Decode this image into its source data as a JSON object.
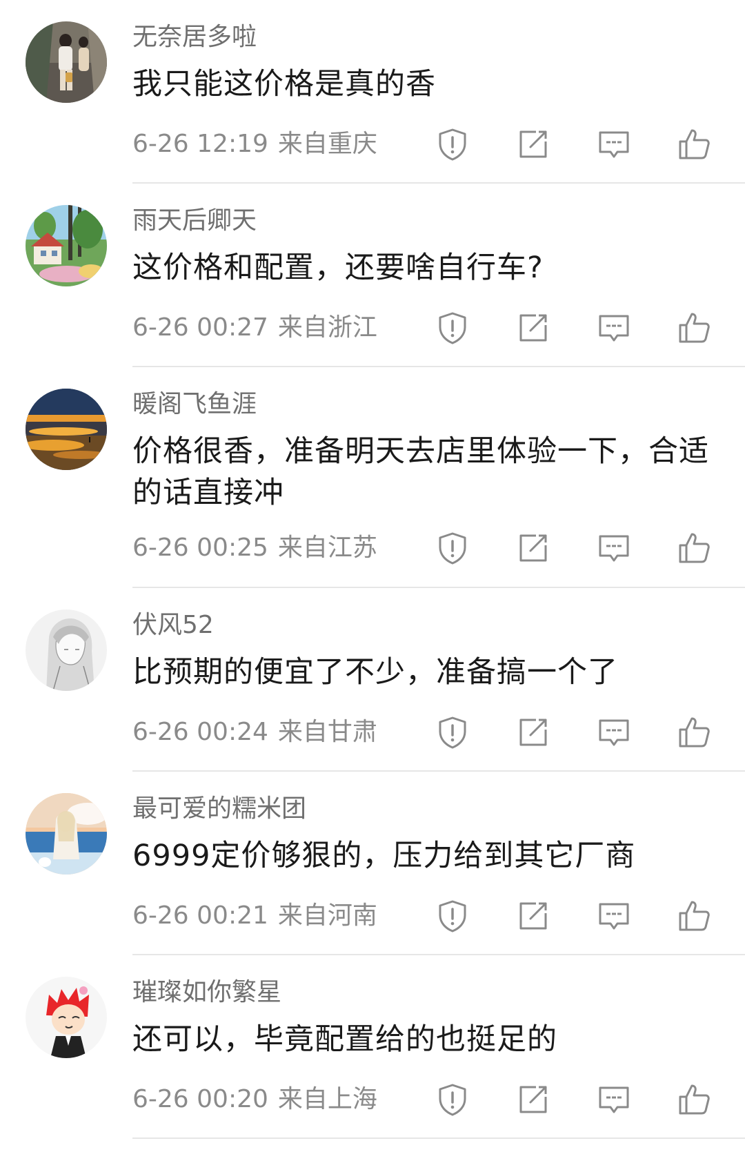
{
  "comments": [
    {
      "username": "无奈居多啦",
      "text": "我只能这价格是真的香",
      "date": "6-26 12:19",
      "location": "来自重庆",
      "avatar_icon": "photo-street-girl"
    },
    {
      "username": "雨天后卿天",
      "text": "这价格和配置，还要啥自行车?",
      "date": "6-26 00:27",
      "location": "来自浙江",
      "avatar_icon": "illustration-house-forest"
    },
    {
      "username": "暖阁飞鱼涯",
      "text": "价格很香，准备明天去店里体验一下，合适的话直接冲",
      "date": "6-26 00:25",
      "location": "来自江苏",
      "avatar_icon": "photo-sunset-sea"
    },
    {
      "username": "伏风52",
      "text": "比预期的便宜了不少，准备搞一个了",
      "date": "6-26 00:24",
      "location": "来自甘肃",
      "avatar_icon": "sketch-girl"
    },
    {
      "username": "最可爱的糯米团",
      "text": "6999定价够狠的，压力给到其它厂商",
      "date": "6-26 00:21",
      "location": "来自河南",
      "avatar_icon": "illustration-girl-sea"
    },
    {
      "username": "璀璨如你繁星",
      "text": "还可以，毕竟配置给的也挺足的",
      "date": "6-26 00:20",
      "location": "来自上海",
      "avatar_icon": "cartoon-red-hair"
    }
  ],
  "colors": {
    "username": "#6f6f6f",
    "text": "#1a1a1a",
    "meta": "#8a8a8a",
    "icon": "#8a8a8a",
    "divider": "#e6e6e6"
  }
}
